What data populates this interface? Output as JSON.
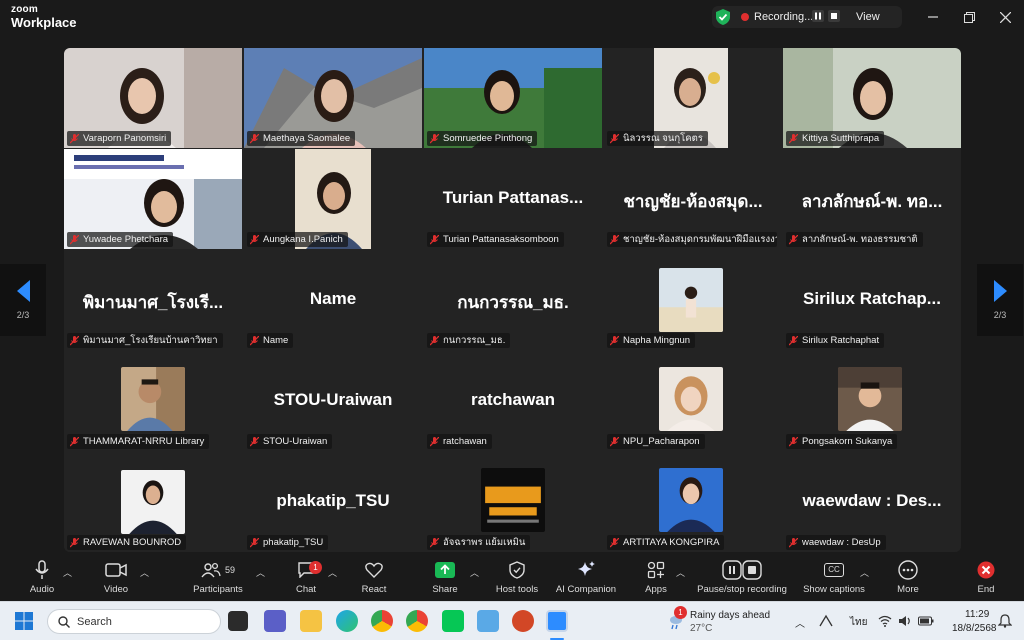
{
  "app": {
    "logo_line1": "zoom",
    "logo_line2": "Workplace"
  },
  "titlebar": {
    "recording_label": "Recording...",
    "view_label": "View"
  },
  "participants_grid": [
    {
      "name": "Varaporn Panomsiri",
      "display": "",
      "video": true
    },
    {
      "name": "Maethaya Saomalee",
      "display": "",
      "video": true
    },
    {
      "name": "Somruedee Pinthong",
      "display": "",
      "video": true
    },
    {
      "name": "นิลวรรณ จนกุโคตร",
      "display": "",
      "video": true
    },
    {
      "name": "Kittiya Sutthiprapa",
      "display": "",
      "video": true
    },
    {
      "name": "Yuwadee Phetchara",
      "display": "",
      "video": true
    },
    {
      "name": "Aungkana I.Panich",
      "display": "",
      "video": true
    },
    {
      "name": "Turian Pattanasaksomboon",
      "display": "Turian  Pattanas...",
      "video": false
    },
    {
      "name": "ชาญชัย-ห้องสมุดกรมพัฒนาฝีมือแรงงาน",
      "display": "ชาญชัย-ห้องสมุด...",
      "video": false
    },
    {
      "name": "ลาภลักษณ์-พ. ทองธรรมชาติ",
      "display": "ลาภลักษณ์-พ. ทอ...",
      "video": false
    },
    {
      "name": "พิมานมาศ_โรงเรียนบ้านคาวิทยา",
      "display": "พิมานมาศ_โรงเรี...",
      "video": false
    },
    {
      "name": "Name",
      "display": "Name",
      "video": false
    },
    {
      "name": "กนกวรรณ_มธ.",
      "display": "กนกวรรณ_มธ.",
      "video": false
    },
    {
      "name": "Napha Mingnun",
      "display": "",
      "video": "photo"
    },
    {
      "name": "Sirilux Ratchaphat",
      "display": "Sirilux  Ratchap...",
      "video": false
    },
    {
      "name": "THAMMARAT-NRRU Library",
      "display": "",
      "video": "photo"
    },
    {
      "name": "STOU-Uraiwan",
      "display": "STOU-Uraiwan",
      "video": false
    },
    {
      "name": "ratchawan",
      "display": "ratchawan",
      "video": false
    },
    {
      "name": "NPU_Pacharapon",
      "display": "",
      "video": "photo"
    },
    {
      "name": "Pongsakorn Sukanya",
      "display": "",
      "video": "photo"
    },
    {
      "name": "RAVEWAN BOUNROD",
      "display": "",
      "video": "photo"
    },
    {
      "name": "phakatip_TSU",
      "display": "phakatip_TSU",
      "video": false
    },
    {
      "name": "อัจฉราพร แย้มเหมิน",
      "display": "",
      "video": "photo"
    },
    {
      "name": "ARTITAYA KONGPIRA",
      "display": "",
      "video": "photo"
    },
    {
      "name": "waewdaw : DesUp",
      "display": "waewdaw : Des...",
      "video": false
    }
  ],
  "pager": {
    "left": "2/3",
    "right": "2/3"
  },
  "toolbar": {
    "audio": "Audio",
    "video": "Video",
    "participants": "Participants",
    "participants_count": "59",
    "chat": "Chat",
    "chat_badge": "1",
    "react": "React",
    "share": "Share",
    "host_tools": "Host tools",
    "ai_companion": "AI Companion",
    "apps": "Apps",
    "recording": "Pause/stop recording",
    "captions": "Show captions",
    "captions_icon": "CC",
    "more": "More",
    "end": "End"
  },
  "taskbar": {
    "search_placeholder": "Search",
    "weather_title": "Rainy days ahead",
    "weather_temp": "27°C",
    "weather_badge": "1",
    "language": "ไทย",
    "time": "11:29",
    "date": "18/8/2568"
  },
  "colors": {
    "accent_blue": "#2d8cff",
    "record_red": "#e02f2f",
    "share_green": "#19b955"
  }
}
